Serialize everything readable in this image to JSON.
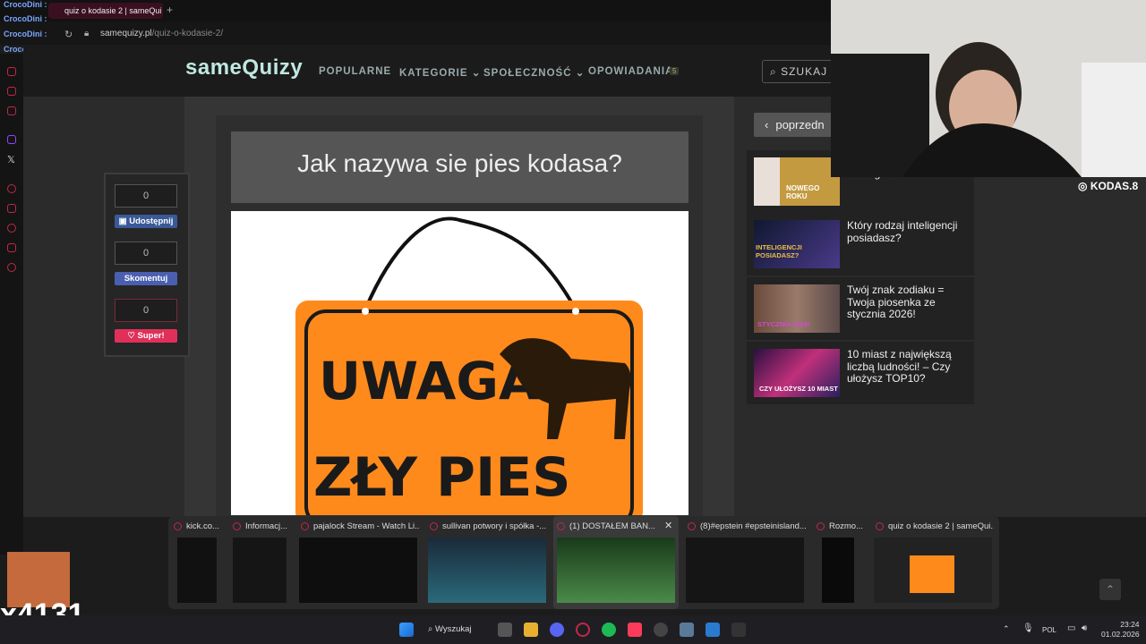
{
  "browser": {
    "tab_title": "quiz o kodasie 2 | sameQui",
    "url_domain": "samequizy.pl",
    "url_path": "/quiz-o-kodasie-2/"
  },
  "site": {
    "logo": "sameQuizy",
    "nav": [
      "POPULARNE",
      "KATEGORIE",
      "SPOŁECZNOŚĆ",
      "OPOWIADANIA"
    ],
    "nav_badge": "5",
    "search_label": "SZUKAJ"
  },
  "share": {
    "counters": [
      "0",
      "0",
      "0"
    ],
    "buttons": [
      "Udostępnij",
      "Skomentuj",
      "Super!"
    ]
  },
  "quiz": {
    "question": "Jak nazywa sie pies kodasa?",
    "image_text_top": "UWAGA!",
    "image_text_bottom": "ZŁY PIES"
  },
  "sidebar": {
    "prev_label": "poprzedn",
    "related": [
      {
        "title": "Nowego Roku!",
        "thumb_text": "NOWEGO ROKU"
      },
      {
        "title": "Który rodzaj inteligencji posiadasz?",
        "thumb_text": "INTELIGENCJI POSIADASZ?"
      },
      {
        "title": "Twój znak zodiaku = Twoja piosenka ze stycznia 2026!",
        "thumb_text": "STYCZNIA 2026!"
      },
      {
        "title": "10 miast z największą liczbą ludności! – Czy ułożysz TOP10?",
        "thumb_text": "CZY UŁOŻYSZ 10 MIAST"
      }
    ]
  },
  "stream": {
    "instagram": "KODAS.8",
    "chat_user": "CrocoDini :",
    "counter": "x4131"
  },
  "previews": [
    "kick.co...",
    "Informacj...",
    "pajalock Stream - Watch Li...",
    "sullivan potwory i spółka -...",
    "(1) DOSTAŁEM BAN...",
    "(8)#epstein #epsteinisland...",
    "Rozmo...",
    "quiz o kodasie 2 | sameQui..."
  ],
  "taskbar": {
    "search": "Wyszukaj",
    "lang": "POL",
    "time": "23:24",
    "date": "01.02.2026"
  },
  "colors": {
    "facebook": "#3b5998",
    "skomentuj": "#4a5fb0",
    "super": "#e0305a",
    "logo": "#bfe8e0",
    "sign_orange": "#ff8a1c"
  }
}
